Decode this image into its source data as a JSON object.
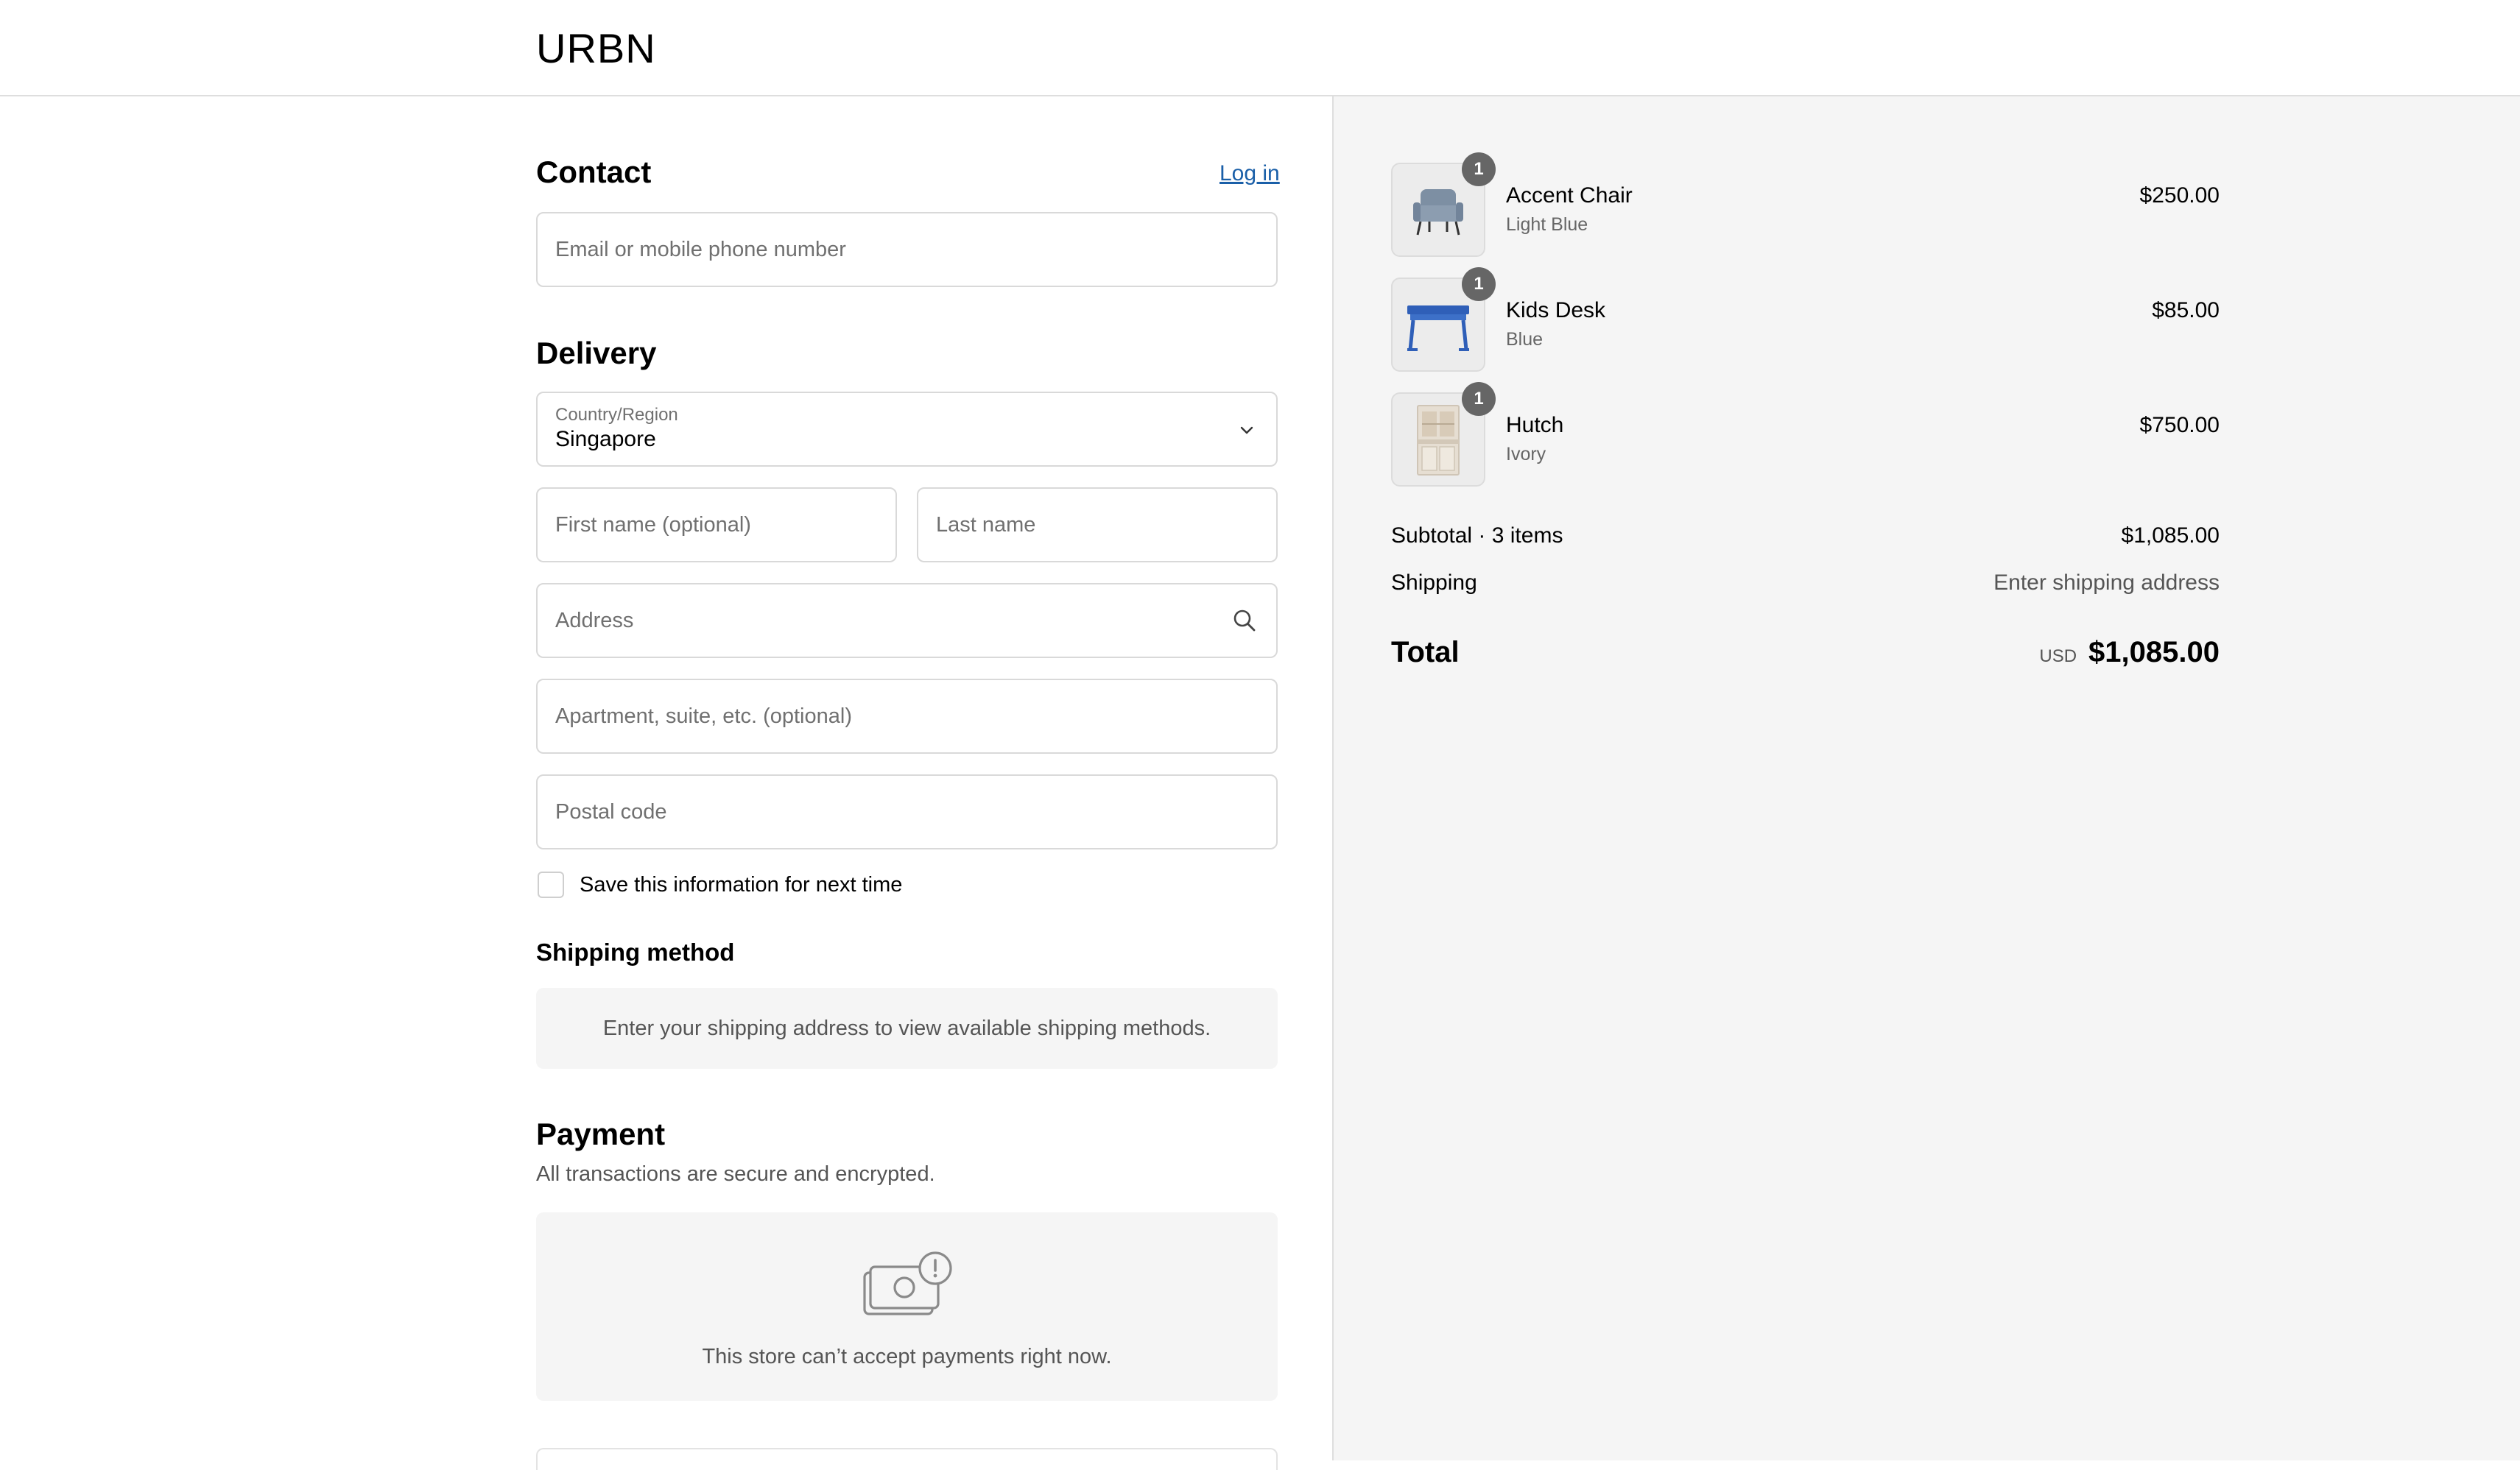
{
  "header": {
    "logo": "URBN"
  },
  "contact": {
    "title": "Contact",
    "login_link": "Log in",
    "email_placeholder": "Email or mobile phone number"
  },
  "delivery": {
    "title": "Delivery",
    "country_label": "Country/Region",
    "country_value": "Singapore",
    "first_name_placeholder": "First name (optional)",
    "last_name_placeholder": "Last name",
    "address_placeholder": "Address",
    "apartment_placeholder": "Apartment, suite, etc. (optional)",
    "postal_placeholder": "Postal code",
    "save_info_label": "Save this information for next time"
  },
  "shipping_method": {
    "title": "Shipping method",
    "notice": "Enter your shipping address to view available shipping methods."
  },
  "payment": {
    "title": "Payment",
    "subtitle": "All transactions are secure and encrypted.",
    "notice": "This store can’t accept payments right now."
  },
  "order": {
    "items": [
      {
        "name": "Accent Chair",
        "variant": "Light Blue",
        "price": "$250.00",
        "quantity": "1",
        "icon": "chair-icon"
      },
      {
        "name": "Kids Desk",
        "variant": "Blue",
        "price": "$85.00",
        "quantity": "1",
        "icon": "desk-icon"
      },
      {
        "name": "Hutch",
        "variant": "Ivory",
        "price": "$750.00",
        "quantity": "1",
        "icon": "hutch-icon"
      }
    ],
    "subtotal_label": "Subtotal · 3 items",
    "subtotal_value": "$1,085.00",
    "shipping_label": "Shipping",
    "shipping_value": "Enter shipping address",
    "total_label": "Total",
    "currency": "USD",
    "total_value": "$1,085.00"
  },
  "colors": {
    "link": "#1a5fa8",
    "summary_bg": "#f5f5f5",
    "badge": "#666666",
    "border": "#d9d9d9"
  }
}
